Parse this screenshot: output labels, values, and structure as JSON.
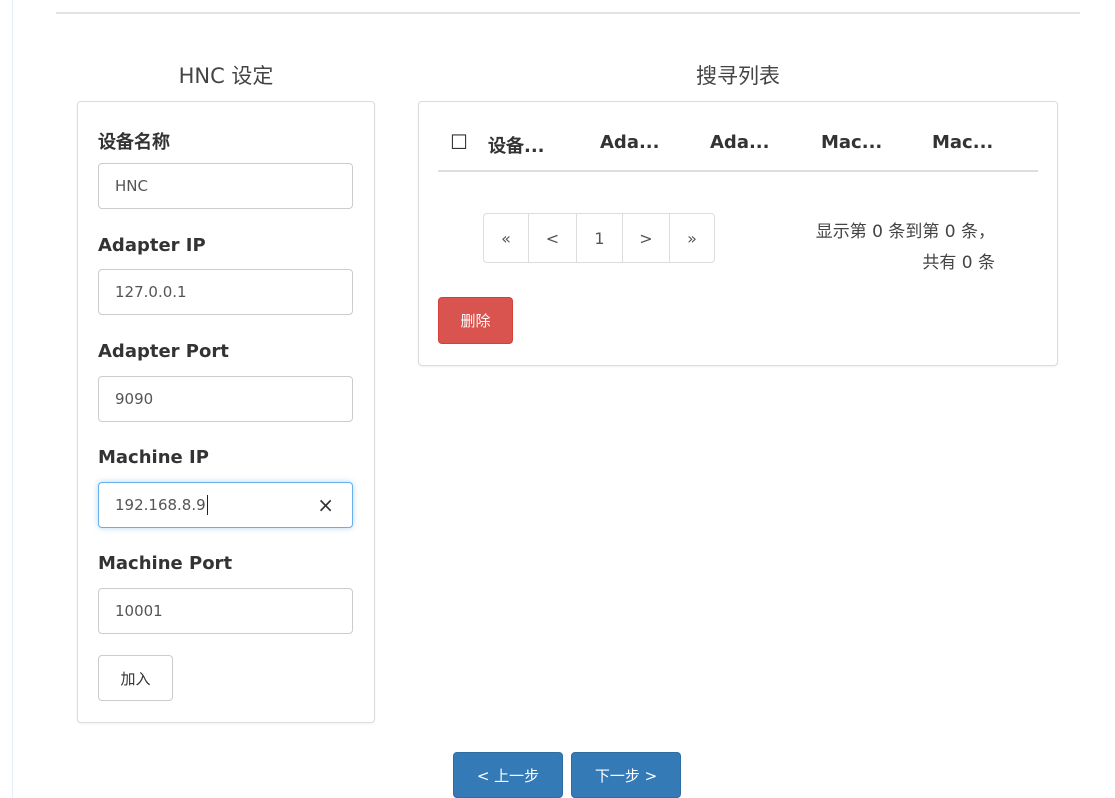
{
  "left_panel": {
    "title": "HNC 设定",
    "fields": [
      {
        "label": "设备名称",
        "value": "HNC"
      },
      {
        "label": "Adapter IP",
        "value": "127.0.0.1"
      },
      {
        "label": "Adapter Port",
        "value": "9090"
      },
      {
        "label": "Machine IP",
        "value": "192.168.8.9"
      },
      {
        "label": "Machine Port",
        "value": "10001"
      }
    ],
    "add_button": "加入",
    "clear_icon": "×"
  },
  "right_panel": {
    "title": "搜寻列表",
    "checkbox_glyph": "☐",
    "columns": [
      "设备...",
      "Ada...",
      "Ada...",
      "Mac...",
      "Mac..."
    ],
    "pager": {
      "first": "«",
      "prev": "<",
      "page": "1",
      "next": ">",
      "last": "»"
    },
    "info_line1": "显示第 0 条到第 0 条，",
    "info_line2": "共有 0 条",
    "delete_button": "删除"
  },
  "footer": {
    "prev_button": "< 上一步",
    "next_button": "下一步 >"
  }
}
